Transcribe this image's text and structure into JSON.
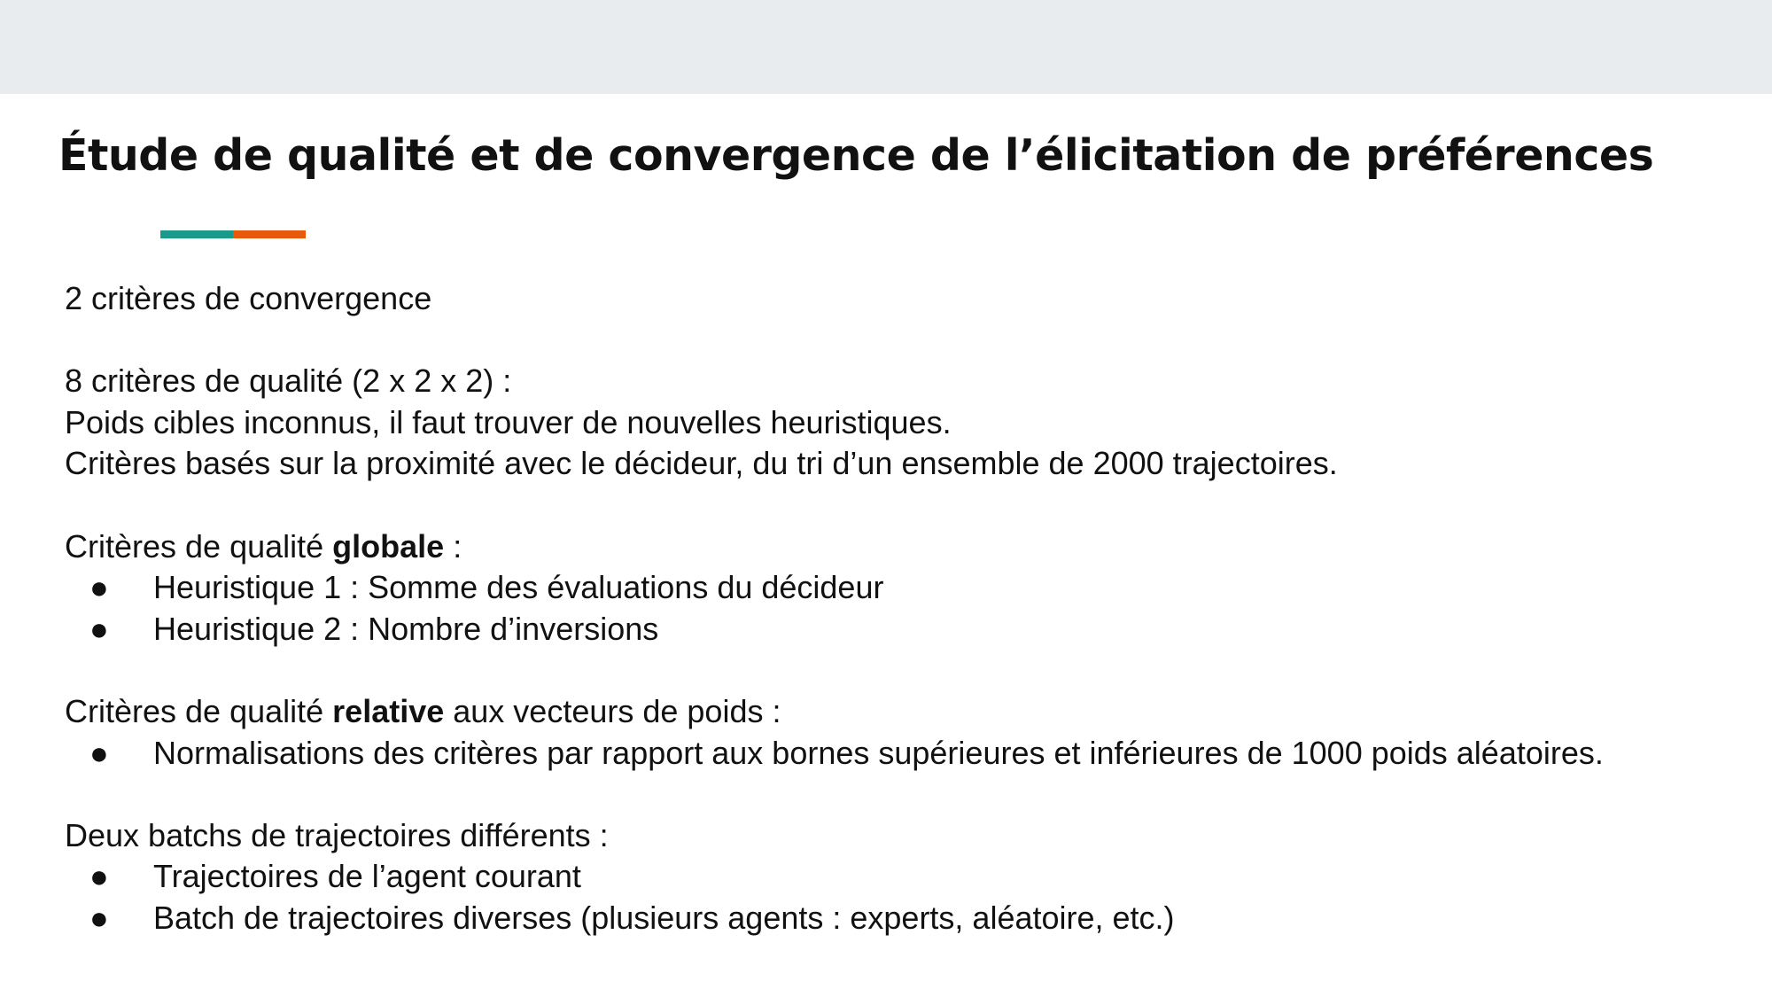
{
  "title": "Étude de qualité et de convergence de l’élicitation de préférences",
  "colors": {
    "top_band": "#e8ecef",
    "accent_teal": "#1a9a8a",
    "accent_orange": "#e8590c",
    "text": "#111111"
  },
  "body": {
    "line1": "2 critères de convergence",
    "line2": "8 critères de qualité (2 x 2 x 2) :",
    "line3": "Poids cibles inconnus, il faut trouver de nouvelles heuristiques.",
    "line4": "Critères basés sur la proximité avec le décideur, du tri d’un ensemble de 2000 trajectoires.",
    "global_section": {
      "prefix": "Critères de qualité ",
      "bold": "globale",
      "suffix": " :",
      "bullets": [
        "Heuristique 1 : Somme des évaluations du décideur",
        "Heuristique 2 : Nombre d’inversions"
      ]
    },
    "relative_section": {
      "prefix": "Critères de qualité ",
      "bold": "relative",
      "suffix": " aux vecteurs de poids :",
      "bullets": [
        "Normalisations des critères par rapport aux bornes supérieures et inférieures de 1000 poids aléatoires."
      ]
    },
    "batch_section": {
      "heading": "Deux batchs de trajectoires différents :",
      "bullets": [
        "Trajectoires de l’agent courant",
        "Batch de trajectoires diverses (plusieurs agents : experts, aléatoire, etc.)"
      ]
    },
    "bullet_glyph": "●"
  }
}
